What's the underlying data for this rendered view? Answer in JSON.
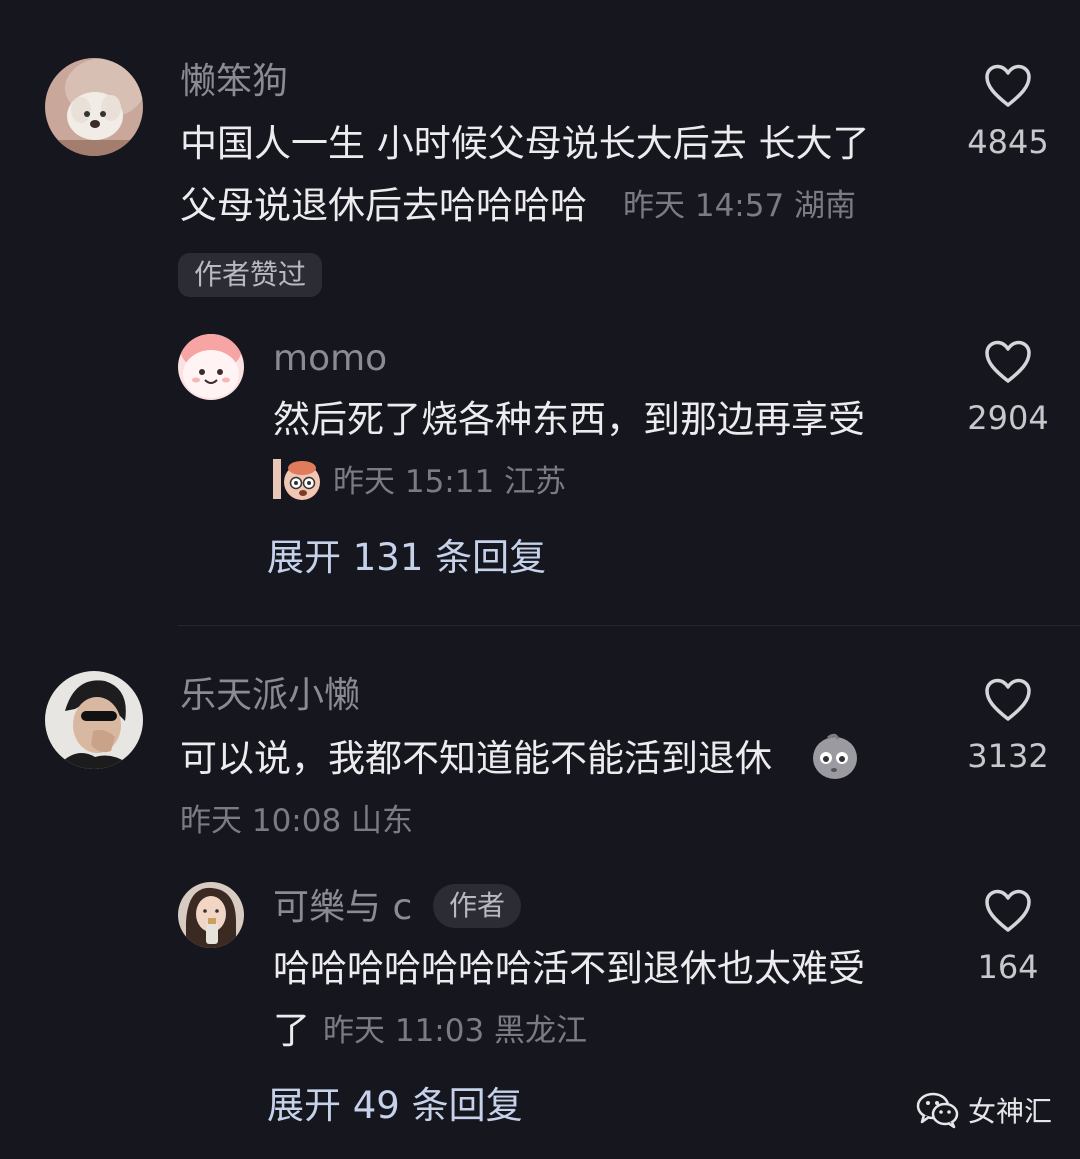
{
  "comments": [
    {
      "username": "懒笨狗",
      "text_line1": "中国人一生 小时候父母说长大后去 长大了",
      "text_line2": "父母说退休后去哈哈哈哈",
      "meta": "昨天 14:57 湖南",
      "badge": "作者赞过",
      "likes": "4845",
      "reply": {
        "username": "momo",
        "text": "然后死了烧各种东西，到那边再享受",
        "meta": "昨天 15:11 江苏",
        "likes": "2904",
        "expand": "展开 131 条回复"
      }
    },
    {
      "username": "乐天派小懒",
      "text": "可以说，我都不知道能不能活到退休",
      "meta": "昨天 10:08 山东",
      "likes": "3132",
      "reply": {
        "username": "可樂与 c",
        "author_tag": "作者",
        "text_line1": "哈哈哈哈哈哈哈活不到退休也太难受",
        "text_line2": "了",
        "meta": "昨天 11:03 黑龙江",
        "likes": "164",
        "expand": "展开 49 条回复"
      }
    }
  ],
  "icons": {
    "like": "heart-outline-icon",
    "emoji": "emoji-face-icon",
    "sticker": "sticker-icon",
    "watermark": "wechat-icon"
  },
  "watermark": {
    "text": "女神汇"
  },
  "colors": {
    "background": "#16161e",
    "expand_link": "#c6d2ea",
    "muted": "#7b7b83"
  }
}
